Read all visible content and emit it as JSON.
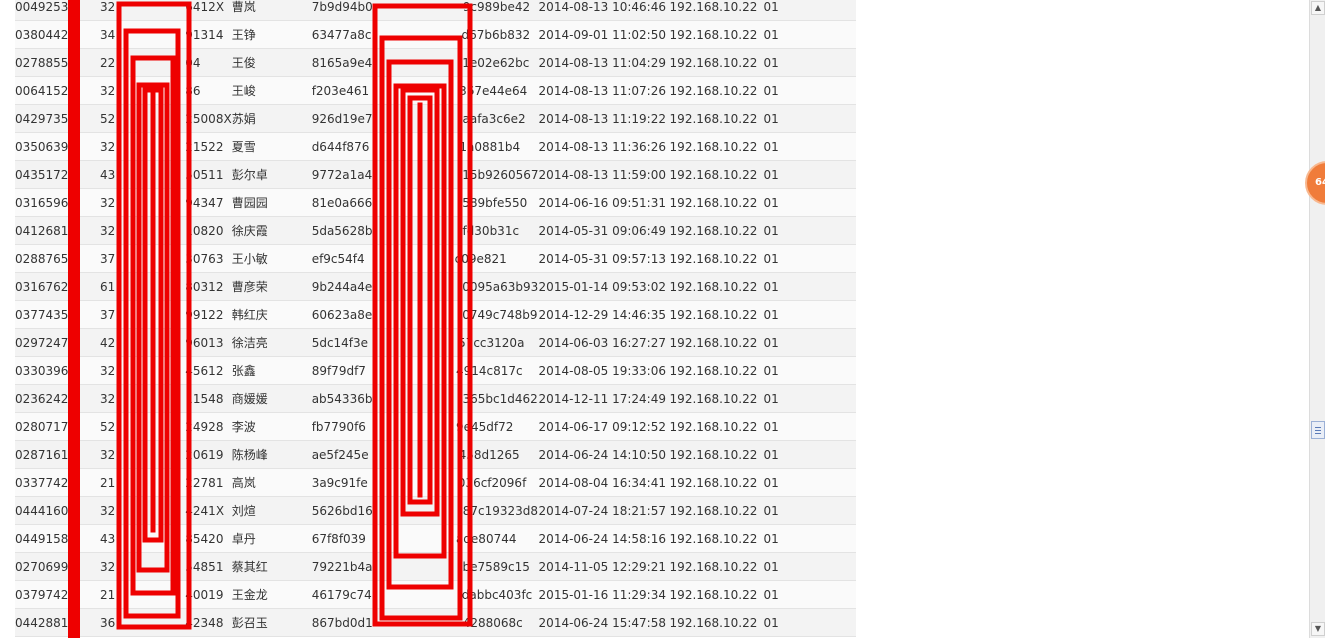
{
  "rows": [
    {
      "id": "0049253",
      "card": "32",
      "card_tail": "6412X",
      "name": "曹岚",
      "hash_head": "7b9d94b0",
      "hash_tail": "9c989be42",
      "time": "2014-08-13 10:46:46",
      "ip": "192.168.10.22",
      "code": "01"
    },
    {
      "id": "0380442",
      "card": "34",
      "card_tail": "91314",
      "name": "王铮",
      "hash_head": "63477a8c",
      "hash_tail": "d67b6b832",
      "time": "2014-09-01 11:02:50",
      "ip": "192.168.10.22",
      "code": "01"
    },
    {
      "id": "0278855",
      "card": "22",
      "card_tail": "04",
      "name": "王俊",
      "hash_head": "8165a9e4",
      "hash_tail": "1e02e62bc",
      "time": "2014-08-13 11:04:29",
      "ip": "192.168.10.22",
      "code": "01"
    },
    {
      "id": "0064152",
      "card": "32",
      "card_tail": "86",
      "name": "王峻",
      "hash_head": "f203e461",
      "hash_tail": "367e44e64",
      "time": "2014-08-13 11:07:26",
      "ip": "192.168.10.22",
      "code": "01"
    },
    {
      "id": "0429735",
      "card": "52",
      "card_tail": "25008X",
      "name": "苏娟",
      "hash_head": "926d19e7",
      "hash_tail": "aafa3c6e2",
      "time": "2014-08-13 11:19:22",
      "ip": "192.168.10.22",
      "code": "01"
    },
    {
      "id": "0350639",
      "card": "32",
      "card_tail": "21522",
      "name": "夏雪",
      "hash_head": "d644f876",
      "hash_tail": "1a0881b4",
      "time": "2014-08-13 11:36:26",
      "ip": "192.168.10.22",
      "code": "01"
    },
    {
      "id": "0435172",
      "card": "43",
      "card_tail": "50511",
      "name": "彭尔卓",
      "hash_head": "9772a1a4",
      "hash_tail": "15b9260567",
      "time": "2014-08-13 11:59:00",
      "ip": "192.168.10.22",
      "code": "01"
    },
    {
      "id": "0316596",
      "card": "32",
      "card_tail": "94347",
      "name": "曹园园",
      "hash_head": "81e0a666",
      "hash_tail": "589bfe550",
      "time": "2014-06-16 09:51:31",
      "ip": "192.168.10.22",
      "code": "01"
    },
    {
      "id": "0412681",
      "card": "32",
      "card_tail": "10820",
      "name": "徐庆霞",
      "hash_head": "5da5628b",
      "hash_tail": "fd30b31c",
      "time": "2014-05-31 09:06:49",
      "ip": "192.168.10.22",
      "code": "01"
    },
    {
      "id": "0288765",
      "card": "37",
      "card_tail": "30763",
      "name": "王小敏",
      "hash_head": "ef9c54f4",
      "hash_tail": "c09e821",
      "time": "2014-05-31 09:57:13",
      "ip": "192.168.10.22",
      "code": "01"
    },
    {
      "id": "0316762",
      "card": "61",
      "card_tail": "80312",
      "name": "曹彦荣",
      "hash_head": "9b244a4e",
      "hash_tail": "0095a63b93",
      "time": "2015-01-14 09:53:02",
      "ip": "192.168.10.22",
      "code": "01"
    },
    {
      "id": "0377435",
      "card": "37",
      "card_tail": "99122",
      "name": "韩红庆",
      "hash_head": "60623a8e",
      "hash_tail": "0749c748b9",
      "time": "2014-12-29 14:46:35",
      "ip": "192.168.10.22",
      "code": "01"
    },
    {
      "id": "0297247",
      "card": "42",
      "card_tail": "96013",
      "name": "徐洁亮",
      "hash_head": "5dc14f3e",
      "hash_tail": "57cc3120a",
      "time": "2014-06-03 16:27:27",
      "ip": "192.168.10.22",
      "code": "01"
    },
    {
      "id": "0330396",
      "card": "32",
      "card_tail": "45612",
      "name": "张鑫",
      "hash_head": "89f79df7",
      "hash_tail": "4914c817c",
      "time": "2014-08-05 19:33:06",
      "ip": "192.168.10.22",
      "code": "01"
    },
    {
      "id": "0236242",
      "card": "32",
      "card_tail": "11548",
      "name": "商媛媛",
      "hash_head": "ab54336b",
      "hash_tail": "365bc1d462",
      "time": "2014-12-11 17:24:49",
      "ip": "192.168.10.22",
      "code": "01"
    },
    {
      "id": "0280717",
      "card": "52",
      "card_tail": "24928",
      "name": "李波",
      "hash_head": "fb7790f6",
      "hash_tail": "9e45df72",
      "time": "2014-06-17 09:12:52",
      "ip": "192.168.10.22",
      "code": "01"
    },
    {
      "id": "0287161",
      "card": "32",
      "card_tail": "20619",
      "name": "陈杨峰",
      "hash_head": "ae5f245e",
      "hash_tail": "458d1265",
      "time": "2014-06-24 14:10:50",
      "ip": "192.168.10.22",
      "code": "01"
    },
    {
      "id": "0337742",
      "card": "21",
      "card_tail": "22781",
      "name": "高岚",
      "hash_head": "3a9c91fe",
      "hash_tail": "036cf2096f",
      "time": "2014-08-04 16:34:41",
      "ip": "192.168.10.22",
      "code": "01"
    },
    {
      "id": "0444160",
      "card": "32",
      "card_tail": "4241X",
      "name": "刘煊",
      "hash_head": "5626bd16",
      "hash_tail": "87c19323d8",
      "time": "2014-07-24 18:21:57",
      "ip": "192.168.10.22",
      "code": "01"
    },
    {
      "id": "0449158",
      "card": "43",
      "card_tail": "85420",
      "name": "卓丹",
      "hash_head": "67f8f039",
      "hash_tail": "ade80744",
      "time": "2014-06-24 14:58:16",
      "ip": "192.168.10.22",
      "code": "01"
    },
    {
      "id": "0270699",
      "card": "32",
      "card_tail": "54851",
      "name": "蔡其红",
      "hash_head": "79221b4a",
      "hash_tail": "be7589c15",
      "time": "2014-11-05 12:29:21",
      "ip": "192.168.10.22",
      "code": "01"
    },
    {
      "id": "0379742",
      "card": "21",
      "card_tail": "40019",
      "name": "王金龙",
      "hash_head": "46179c74",
      "hash_tail": "dabbc403fc",
      "time": "2015-01-16 11:29:34",
      "ip": "192.168.10.22",
      "code": "01"
    },
    {
      "id": "0442881",
      "card": "36",
      "card_tail": "42348",
      "name": "彭召玉",
      "hash_head": "867bd0d1",
      "hash_tail": "4288068c",
      "time": "2014-06-24 15:47:58",
      "ip": "192.168.10.22",
      "code": "01"
    }
  ],
  "badge": {
    "text": "64"
  },
  "colors": {
    "redaction": "#ee0000",
    "row_odd": "#f3f3f3",
    "row_even": "#fafafa",
    "badge": "#f07c3a"
  },
  "icons": {
    "scroll_up": "triangle-up-icon",
    "scroll_down": "triangle-down-icon",
    "thumb": "grip-lines-icon"
  }
}
